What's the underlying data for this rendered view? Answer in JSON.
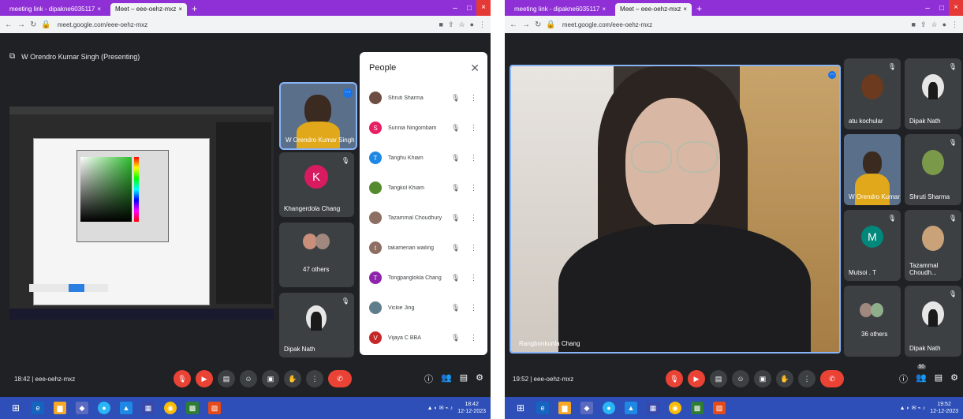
{
  "left": {
    "tabs": [
      {
        "label": "meeting link - dipakne6035117",
        "active": false
      },
      {
        "label": "Meet – eee-oehz-mxz",
        "active": true
      }
    ],
    "url": "meet.google.com/eee-oehz-mxz",
    "presenter_header": "W Orendro Kumar Singh (Presenting)",
    "tiles": [
      {
        "name": "W Orendro Kumar Singh",
        "kind": "video"
      },
      {
        "name": "Khangerdola Chang",
        "kind": "avatar",
        "letter": "K",
        "color": "#d81b60"
      },
      {
        "name": "47 others",
        "kind": "group"
      },
      {
        "name": "Dipak Nath",
        "kind": "photo"
      }
    ],
    "people_panel": {
      "title": "People",
      "close_label": "✕",
      "members": [
        {
          "name": "Shruti Sharma",
          "initial": "",
          "color": "#6d4c41"
        },
        {
          "name": "Sunnia Ningombam",
          "initial": "S",
          "color": "#e91e63"
        },
        {
          "name": "Tanghu Khiam",
          "initial": "T",
          "color": "#1e88e5"
        },
        {
          "name": "Tangkol Khiam",
          "initial": "",
          "color": "#558b2f"
        },
        {
          "name": "Tazammal Choudhury",
          "initial": "",
          "color": "#8d6e63"
        },
        {
          "name": "takamenan wailing",
          "initial": "t",
          "color": "#8d6e63"
        },
        {
          "name": "Tongpanglokla Chang",
          "initial": "T",
          "color": "#8e24aa"
        },
        {
          "name": "Vickie Jing",
          "initial": "",
          "color": "#607d8b"
        },
        {
          "name": "Vijaya C BBA",
          "initial": "V",
          "color": "#c62828"
        }
      ]
    },
    "meeting_info": "18:42  |  eee-oehz-mxz",
    "clock": {
      "time": "18:42",
      "date": "12-12-2023"
    }
  },
  "right": {
    "tabs": [
      {
        "label": "meeting link - dipakne6035117",
        "active": false
      },
      {
        "label": "Meet – eee-oehz-mxz",
        "active": true
      }
    ],
    "url": "meet.google.com/eee-oehz-mxz",
    "speaker_name": "Rangbonkunla Chang",
    "tiles": [
      {
        "name": "atu kochular",
        "kind": "photo"
      },
      {
        "name": "Dipak Nath",
        "kind": "photo"
      },
      {
        "name": "W Orendro Kumar",
        "kind": "video"
      },
      {
        "name": "Shruti Sharma",
        "kind": "photo"
      },
      {
        "name": "Mutsoi . T",
        "kind": "avatar",
        "letter": "M",
        "color": "#00897b"
      },
      {
        "name": "Tazammal Choudh...",
        "kind": "photo"
      },
      {
        "name": "36 others",
        "kind": "group"
      },
      {
        "name": "Dipak Nath",
        "kind": "photo"
      }
    ],
    "meeting_info": "19:52  |  eee-oehz-mxz",
    "participant_count": "50",
    "clock": {
      "time": "19:52",
      "date": "12-12-2023"
    }
  },
  "icons": {
    "mic": "🎤",
    "more": "⋮",
    "end_call": "✆",
    "windows": "⊞"
  }
}
